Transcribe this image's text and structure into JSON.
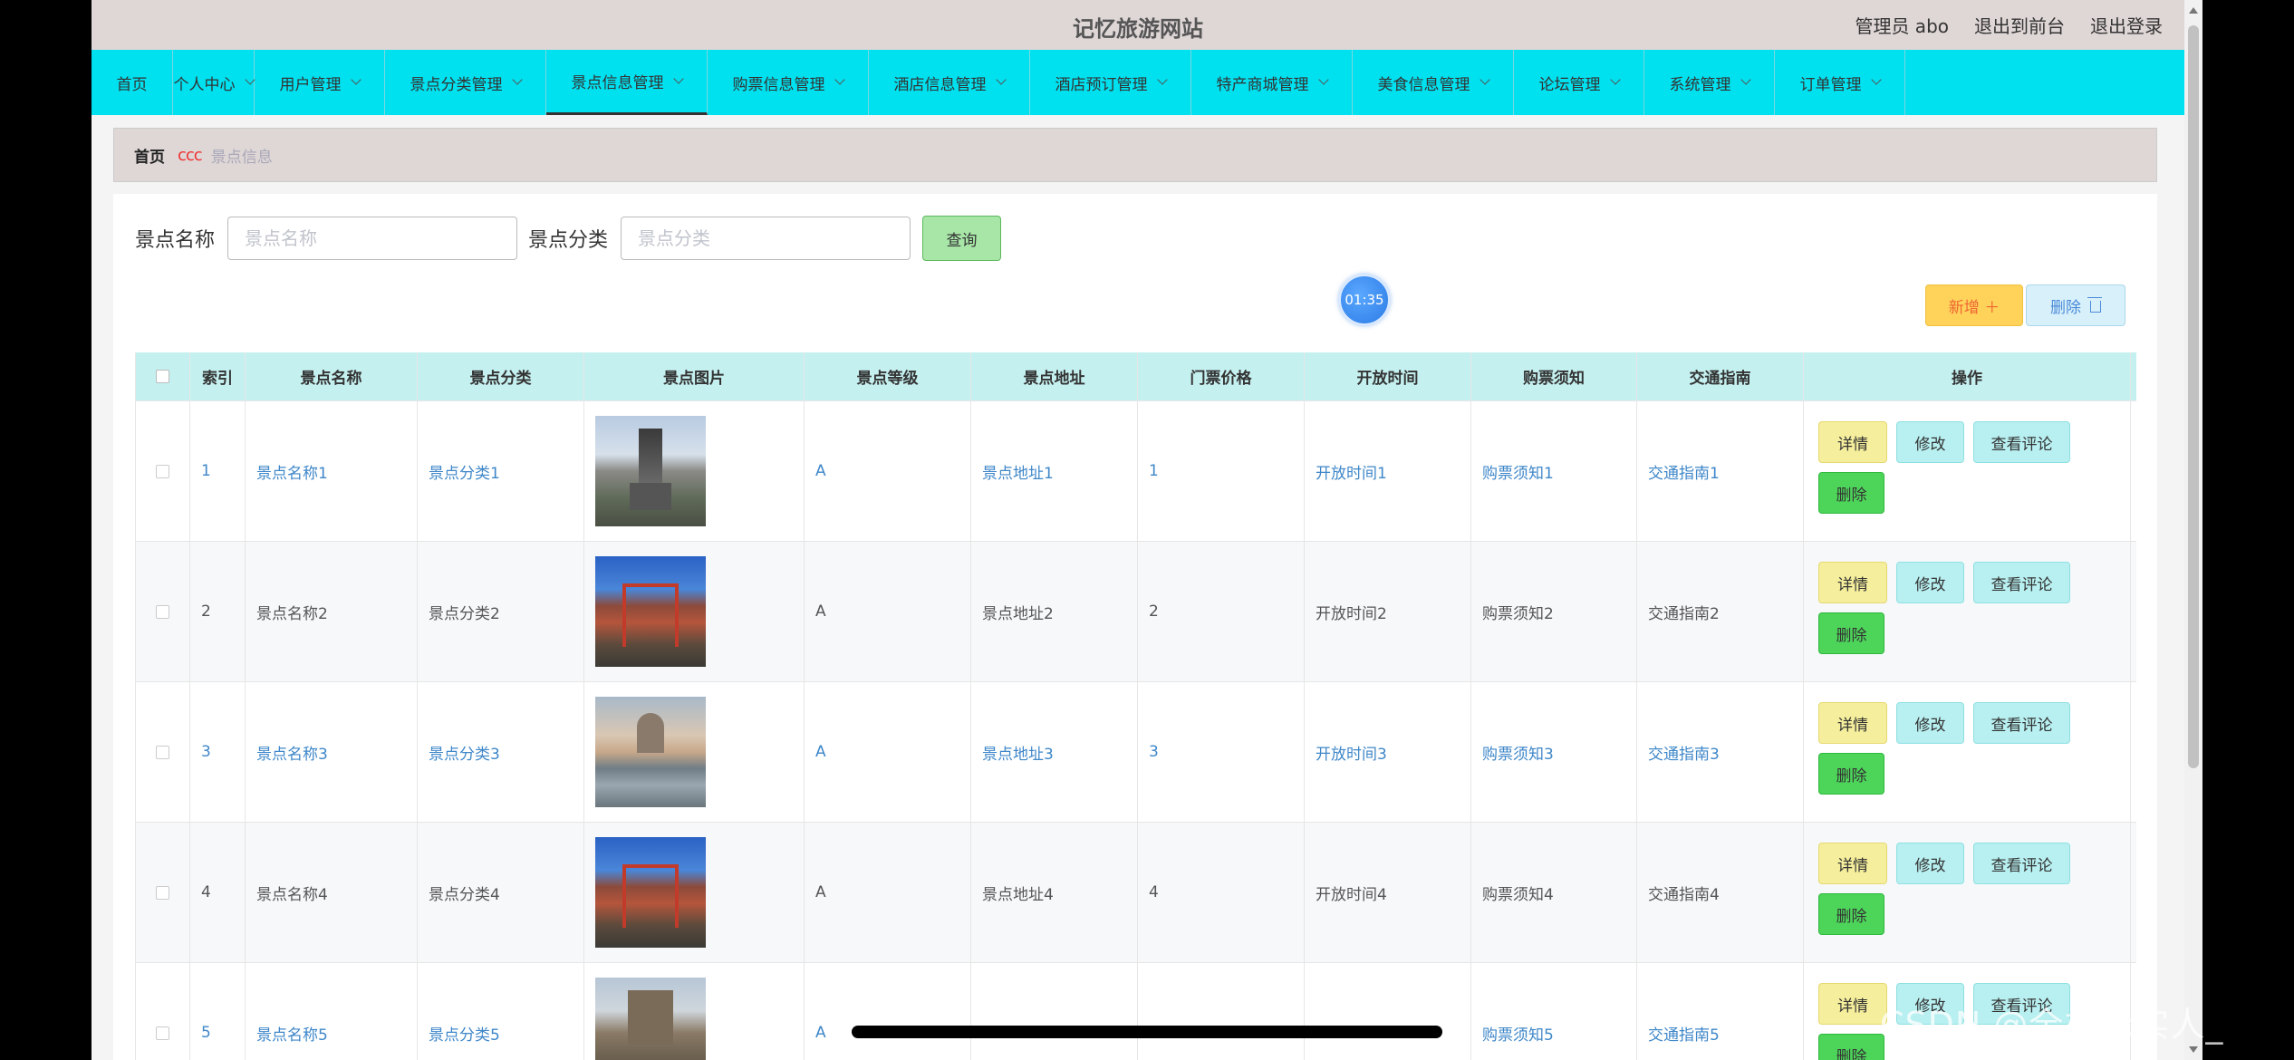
{
  "header": {
    "site_title": "记忆旅游网站",
    "admin_label": "管理员 abo",
    "back_to_front": "退出到前台",
    "logout": "退出登录"
  },
  "nav": {
    "items": [
      {
        "label": "首页",
        "has_dropdown": false
      },
      {
        "label": "个人中心",
        "has_dropdown": true
      },
      {
        "label": "用户管理",
        "has_dropdown": true
      },
      {
        "label": "景点分类管理",
        "has_dropdown": true
      },
      {
        "label": "景点信息管理",
        "has_dropdown": true,
        "active": true
      },
      {
        "label": "购票信息管理",
        "has_dropdown": true
      },
      {
        "label": "酒店信息管理",
        "has_dropdown": true
      },
      {
        "label": "酒店预订管理",
        "has_dropdown": true
      },
      {
        "label": "特产商城管理",
        "has_dropdown": true
      },
      {
        "label": "美食信息管理",
        "has_dropdown": true
      },
      {
        "label": "论坛管理",
        "has_dropdown": true
      },
      {
        "label": "系统管理",
        "has_dropdown": true
      },
      {
        "label": "订单管理",
        "has_dropdown": true
      }
    ]
  },
  "breadcrumb": {
    "home": "首页",
    "separator": "ccc",
    "current": "景点信息"
  },
  "search": {
    "name_label": "景点名称",
    "name_placeholder": "景点名称",
    "category_label": "景点分类",
    "category_placeholder": "景点分类",
    "query_button": "查询"
  },
  "timer": "01:35",
  "toolbar": {
    "add_label": "新增 ＋",
    "delete_label": "删除"
  },
  "table": {
    "headers": [
      "索引",
      "景点名称",
      "景点分类",
      "景点图片",
      "景点等级",
      "景点地址",
      "门票价格",
      "开放时间",
      "购票须知",
      "交通指南",
      "操作"
    ],
    "actions": {
      "detail": "详情",
      "edit": "修改",
      "review": "查看评论",
      "delete": "删除"
    },
    "rows": [
      {
        "idx": "1",
        "name": "景点名称1",
        "category": "景点分类1",
        "level": "A",
        "address": "景点地址1",
        "price": "1",
        "open_time": "开放时间1",
        "notice": "购票须知1",
        "traffic": "交通指南1"
      },
      {
        "idx": "2",
        "name": "景点名称2",
        "category": "景点分类2",
        "level": "A",
        "address": "景点地址2",
        "price": "2",
        "open_time": "开放时间2",
        "notice": "购票须知2",
        "traffic": "交通指南2"
      },
      {
        "idx": "3",
        "name": "景点名称3",
        "category": "景点分类3",
        "level": "A",
        "address": "景点地址3",
        "price": "3",
        "open_time": "开放时间3",
        "notice": "购票须知3",
        "traffic": "交通指南3"
      },
      {
        "idx": "4",
        "name": "景点名称4",
        "category": "景点分类4",
        "level": "A",
        "address": "景点地址4",
        "price": "4",
        "open_time": "开放时间4",
        "notice": "购票须知4",
        "traffic": "交通指南4"
      },
      {
        "idx": "5",
        "name": "景点名称5",
        "category": "景点分类5",
        "level": "A",
        "address": "",
        "price": "",
        "open_time": "",
        "notice": "购票须知5",
        "traffic": "交通指南5"
      }
    ]
  },
  "watermark": "CSDN @全栈老实人_",
  "colors": {
    "nav_bg": "#00e1f0",
    "header_bg": "#dfd6d6",
    "table_head_bg": "#c5f0f0",
    "link": "#3f87c9"
  }
}
